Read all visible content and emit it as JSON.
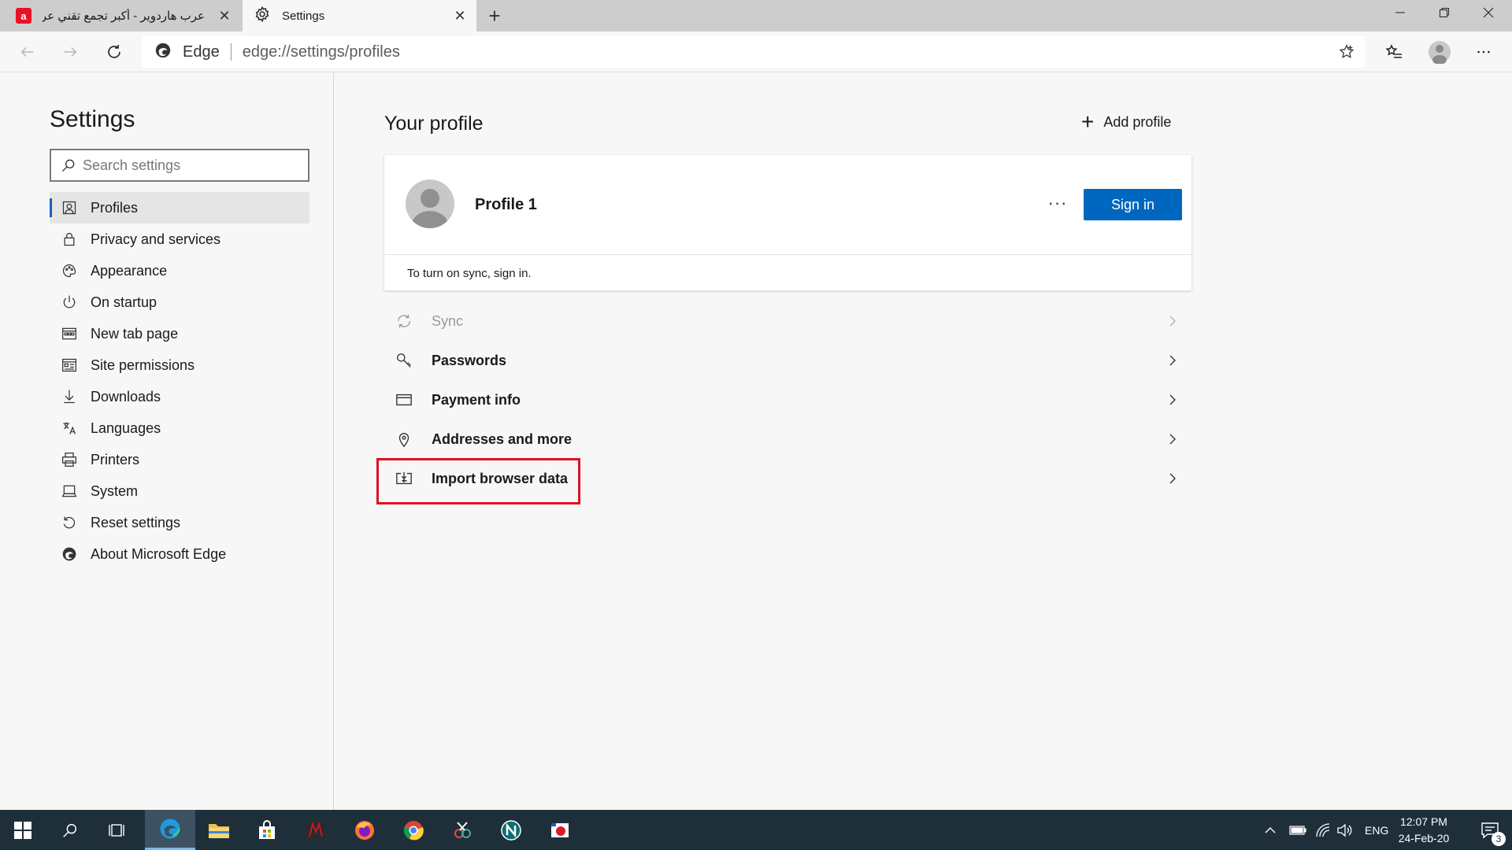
{
  "tabs": [
    {
      "title": "عرب هاردوير - أكبر تجمع تقني عربي",
      "favicon": "arabhardware-favicon",
      "active": false
    },
    {
      "title": "Settings",
      "favicon": "gear-icon",
      "active": true
    }
  ],
  "address": {
    "site_label": "Edge",
    "url": "edge://settings/profiles"
  },
  "sidebar": {
    "title": "Settings",
    "search_placeholder": "Search settings",
    "items": [
      {
        "label": "Profiles",
        "icon": "profile-icon",
        "active": true
      },
      {
        "label": "Privacy and services",
        "icon": "lock-icon"
      },
      {
        "label": "Appearance",
        "icon": "palette-icon"
      },
      {
        "label": "On startup",
        "icon": "power-icon"
      },
      {
        "label": "New tab page",
        "icon": "new-tab-icon"
      },
      {
        "label": "Site permissions",
        "icon": "site-permissions-icon"
      },
      {
        "label": "Downloads",
        "icon": "download-icon"
      },
      {
        "label": "Languages",
        "icon": "languages-icon"
      },
      {
        "label": "Printers",
        "icon": "printer-icon"
      },
      {
        "label": "System",
        "icon": "laptop-icon"
      },
      {
        "label": "Reset settings",
        "icon": "reset-icon"
      },
      {
        "label": "About Microsoft Edge",
        "icon": "edge-logo-icon"
      }
    ]
  },
  "main": {
    "heading": "Your profile",
    "add_profile_label": "Add profile",
    "profile_card": {
      "name": "Profile 1",
      "more_label": "···",
      "sign_in_label": "Sign in",
      "sync_note": "To turn on sync, sign in."
    },
    "rows": [
      {
        "label": "Sync",
        "icon": "sync-icon",
        "disabled": true
      },
      {
        "label": "Passwords",
        "icon": "key-icon"
      },
      {
        "label": "Payment info",
        "icon": "credit-card-icon"
      },
      {
        "label": "Addresses and more",
        "icon": "location-pin-icon"
      },
      {
        "label": "Import browser data",
        "icon": "import-icon",
        "highlighted": true
      }
    ]
  },
  "taskbar": {
    "language": "ENG",
    "time": "12:07 PM",
    "date": "24-Feb-20",
    "notification_count": "3"
  },
  "colors": {
    "accent": "#0067c0",
    "highlight_box": "#e0121f",
    "taskbar": "#1f2f3a"
  }
}
